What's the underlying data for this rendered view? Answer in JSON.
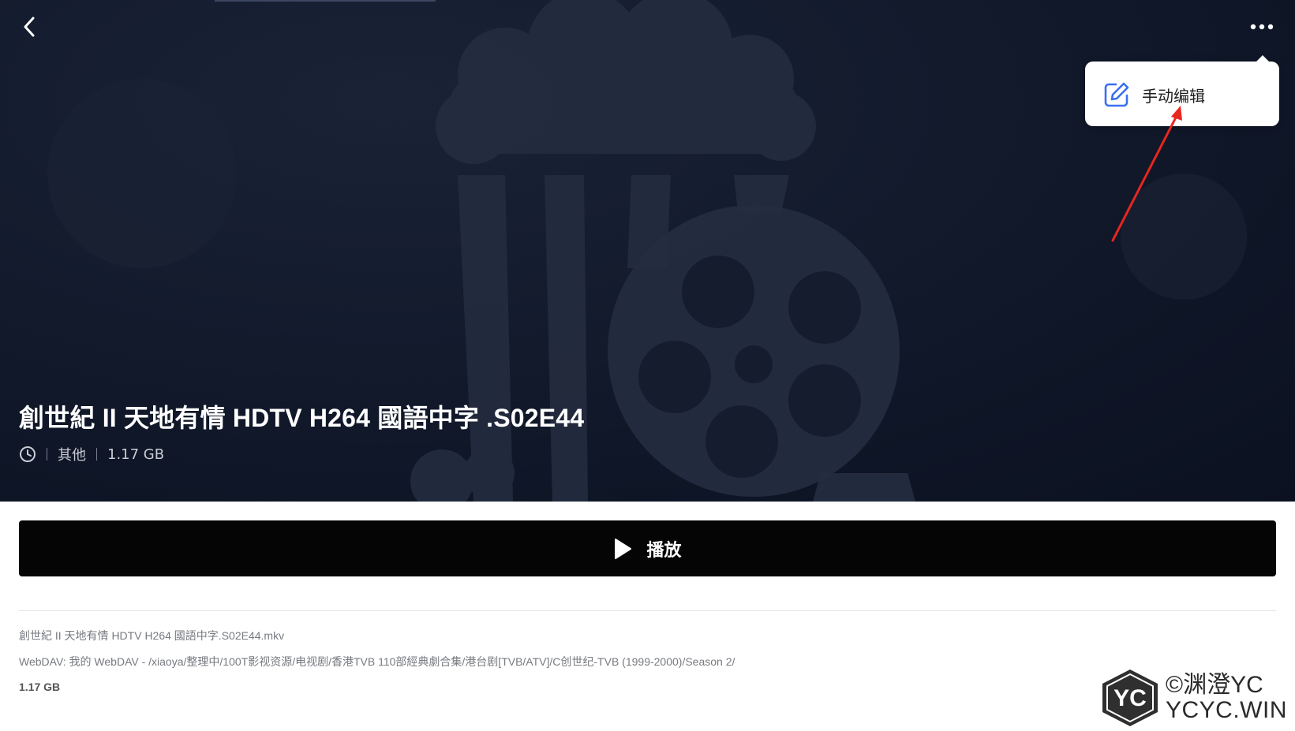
{
  "header": {
    "back_icon": "chevron-left-icon",
    "more_icon": "more-horizontal-icon"
  },
  "menu": {
    "items": [
      {
        "label": "手动编辑",
        "icon": "edit-pencil-icon",
        "icon_color": "#3a6ff2"
      }
    ]
  },
  "media": {
    "title": "創世紀 II 天地有情 HDTV H264 國語中字 .S02E44",
    "meta": {
      "clock_icon": "clock-icon",
      "category": "其他",
      "size": "1.17 GB"
    },
    "play_label": "播放",
    "filename": "創世紀 II 天地有情 HDTV H264 國語中字.S02E44.mkv",
    "path": "WebDAV: 我的 WebDAV - /xiaoya/整理中/100T影视资源/电视剧/香港TVB 110部經典劇合集/港台剧[TVB/ATV]/C创世纪-TVB (1999-2000)/Season 2/",
    "file_size": "1.17 GB"
  },
  "watermark": {
    "badge": "YC",
    "line1": "©渊澄YC",
    "line2": "YCYC.WIN"
  },
  "colors": {
    "hero_bg": "#121a2c",
    "accent_blue": "#3a6ff2",
    "annotation_red": "#e8261e",
    "play_bg": "#050505"
  }
}
